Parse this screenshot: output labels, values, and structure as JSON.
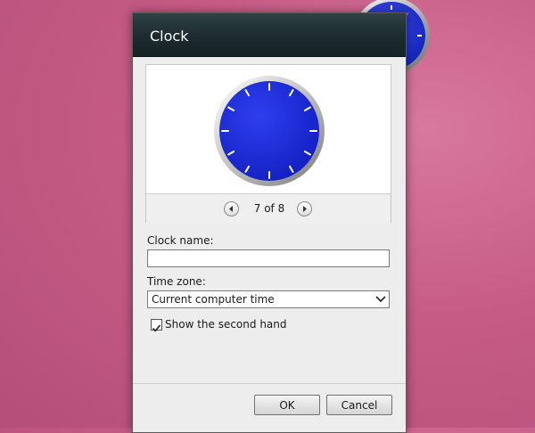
{
  "dialog": {
    "title": "Clock",
    "pager": {
      "text": "7 of 8"
    },
    "clock_name": {
      "label": "Clock name:",
      "value": "",
      "placeholder": ""
    },
    "time_zone": {
      "label": "Time zone:",
      "selected": "Current computer time"
    },
    "second_hand": {
      "label": "Show the second hand",
      "checked": true
    },
    "buttons": {
      "ok": "OK",
      "cancel": "Cancel"
    }
  },
  "colors": {
    "clock_face": "#1f2fd6",
    "titlebar": "#1c2b2f",
    "background": "#c65c86"
  },
  "icons": [
    "chevron-left-icon",
    "chevron-right-icon",
    "dropdown-arrow-icon",
    "checkmark-icon",
    "clock-gadget-icon"
  ]
}
